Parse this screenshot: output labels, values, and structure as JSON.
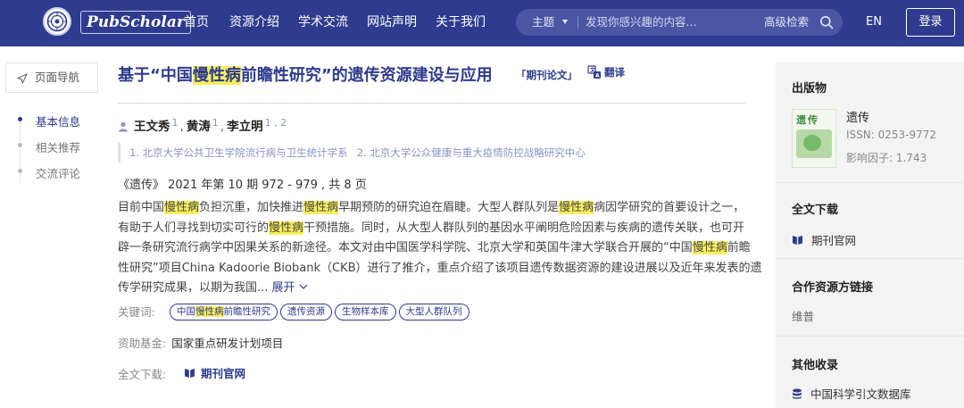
{
  "header": {
    "logo_text": "PubScholar",
    "nav": [
      "首页",
      "资源介绍",
      "学术交流",
      "网站声明",
      "关于我们"
    ],
    "search": {
      "scope": "主题",
      "placeholder": "发现你感兴趣的内容...",
      "advanced": "高级检索"
    },
    "lang": "EN",
    "login": "登录"
  },
  "left_nav": {
    "title": "页面导航",
    "items": [
      "基本信息",
      "相关推荐",
      "交流评论"
    ]
  },
  "article": {
    "title_parts": [
      "基于“中国",
      "慢性病",
      "前瞻性研究”的遗传资源建设与应用"
    ],
    "type_tag": "「期刊论文」",
    "translate": "翻译",
    "authors": [
      {
        "name": "王文秀",
        "sup": "1"
      },
      {
        "name": "黄涛",
        "sup": "1"
      },
      {
        "name": "李立明",
        "sup": "1 , 2"
      }
    ],
    "affiliations": [
      "1. 北京大学公共卫生学院流行病与卫生统计学系",
      "2. 北京大学公众健康与重大疫情防控战略研究中心"
    ],
    "source": "《遗传》 2021 年第 10 期 972 - 979 , 共 8 页",
    "abstract_lines": [
      [
        "目前中国",
        "慢性病",
        "负担沉重，加快推进",
        "慢性病",
        "早期预防的研究迫在眉睫。大型人群队列是",
        "慢性病",
        "病因学研究的首要设计之一，"
      ],
      [
        "有助于人们寻找到切实可行的",
        "慢性病",
        "干预措施。同时，从大型人群队列的基因水平阐明危险因素与疾病的遗传关联，也可开"
      ],
      [
        "辟一条研究流行病学中因果关系的新途径。本文对由中国医学科学院、北京大学和英国牛津大学联合开展的“中国",
        "慢性病",
        "前瞻"
      ],
      [
        "性研究”项目China Kadoorie Biobank（CKB）进行了推介，重点介绍了该项目遗传数据资源的建设进展以及近年来发表的遗"
      ],
      [
        "传学研究成果，以期为我国... "
      ]
    ],
    "expand": "展开",
    "keywords_label": "关键词:",
    "keywords": [
      [
        "中国",
        "慢性病",
        "前瞻性研究"
      ],
      [
        "遗传资源"
      ],
      [
        "生物样本库"
      ],
      [
        "大型人群队列"
      ]
    ],
    "funding_label": "资助基金:",
    "funding": "国家重点研发计划项目",
    "download_label": "全文下载:",
    "download_link": "期刊官网"
  },
  "sidebar": {
    "publication_title": "出版物",
    "cover_text": "遗传",
    "journal_name": "遗传",
    "issn": "ISSN: 0253-9772",
    "impact": "影响因子: 1.743",
    "fulltext_title": "全文下载",
    "fulltext_link": "期刊官网",
    "partner_title": "合作资源方链接",
    "partner": "维普",
    "other_title": "其他收录",
    "other_link": "中国科学引文数据库"
  },
  "colors": {
    "brand": "#2e3b8e",
    "highlight": "#f7ef5c",
    "sidebar_bg": "#f3f3f3"
  }
}
